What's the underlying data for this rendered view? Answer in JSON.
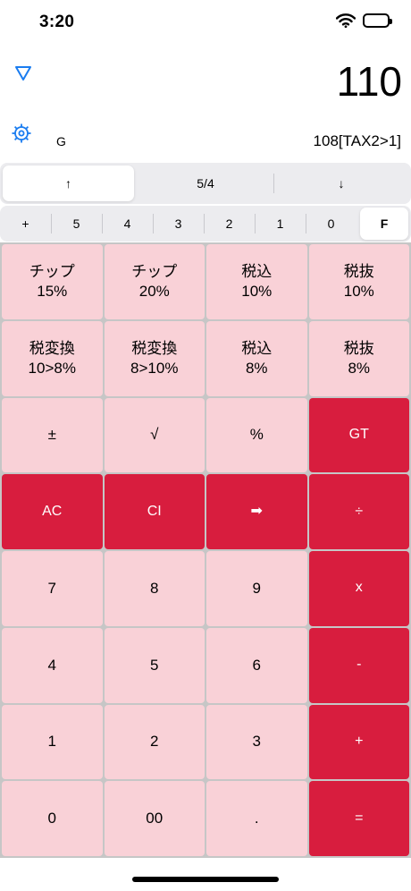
{
  "status_bar": {
    "time": "3:20"
  },
  "display": {
    "main_value": "110",
    "mode": "G",
    "expression": "108[TAX2>1]"
  },
  "nav": [
    {
      "label": "↑",
      "selected": true
    },
    {
      "label": "5/4",
      "selected": false
    },
    {
      "label": "↓",
      "selected": false
    }
  ],
  "decimal_options": [
    {
      "label": "+"
    },
    {
      "label": "5"
    },
    {
      "label": "4"
    },
    {
      "label": "3"
    },
    {
      "label": "2"
    },
    {
      "label": "1"
    },
    {
      "label": "0"
    },
    {
      "label": "F",
      "selected": true
    }
  ],
  "keys": [
    {
      "l1": "チップ",
      "l2": "15%"
    },
    {
      "l1": "チップ",
      "l2": "20%"
    },
    {
      "l1": "税込",
      "l2": "10%"
    },
    {
      "l1": "税抜",
      "l2": "10%"
    },
    {
      "l1": "税変換",
      "l2": "10>8%"
    },
    {
      "l1": "税変換",
      "l2": "8>10%"
    },
    {
      "l1": "税込",
      "l2": "8%"
    },
    {
      "l1": "税抜",
      "l2": "8%"
    },
    {
      "l1": "±"
    },
    {
      "l1": "√"
    },
    {
      "l1": "%"
    },
    {
      "l1": "GT",
      "accent": true
    },
    {
      "l1": "AC",
      "accent": true
    },
    {
      "l1": "CI",
      "accent": true
    },
    {
      "l1": "➡",
      "accent": true
    },
    {
      "l1": "÷",
      "accent": true
    },
    {
      "l1": "7"
    },
    {
      "l1": "8"
    },
    {
      "l1": "9"
    },
    {
      "l1": "x",
      "accent": true
    },
    {
      "l1": "4"
    },
    {
      "l1": "5"
    },
    {
      "l1": "6"
    },
    {
      "l1": "-",
      "accent": true
    },
    {
      "l1": "1"
    },
    {
      "l1": "2"
    },
    {
      "l1": "3"
    },
    {
      "l1": "+",
      "accent": true
    },
    {
      "l1": "0"
    },
    {
      "l1": "00"
    },
    {
      "l1": "."
    },
    {
      "l1": "=",
      "accent": true
    }
  ],
  "colors": {
    "key_light": "#f9d1d7",
    "key_accent": "#d81d3e",
    "icon_blue": "#1a7cf0"
  }
}
